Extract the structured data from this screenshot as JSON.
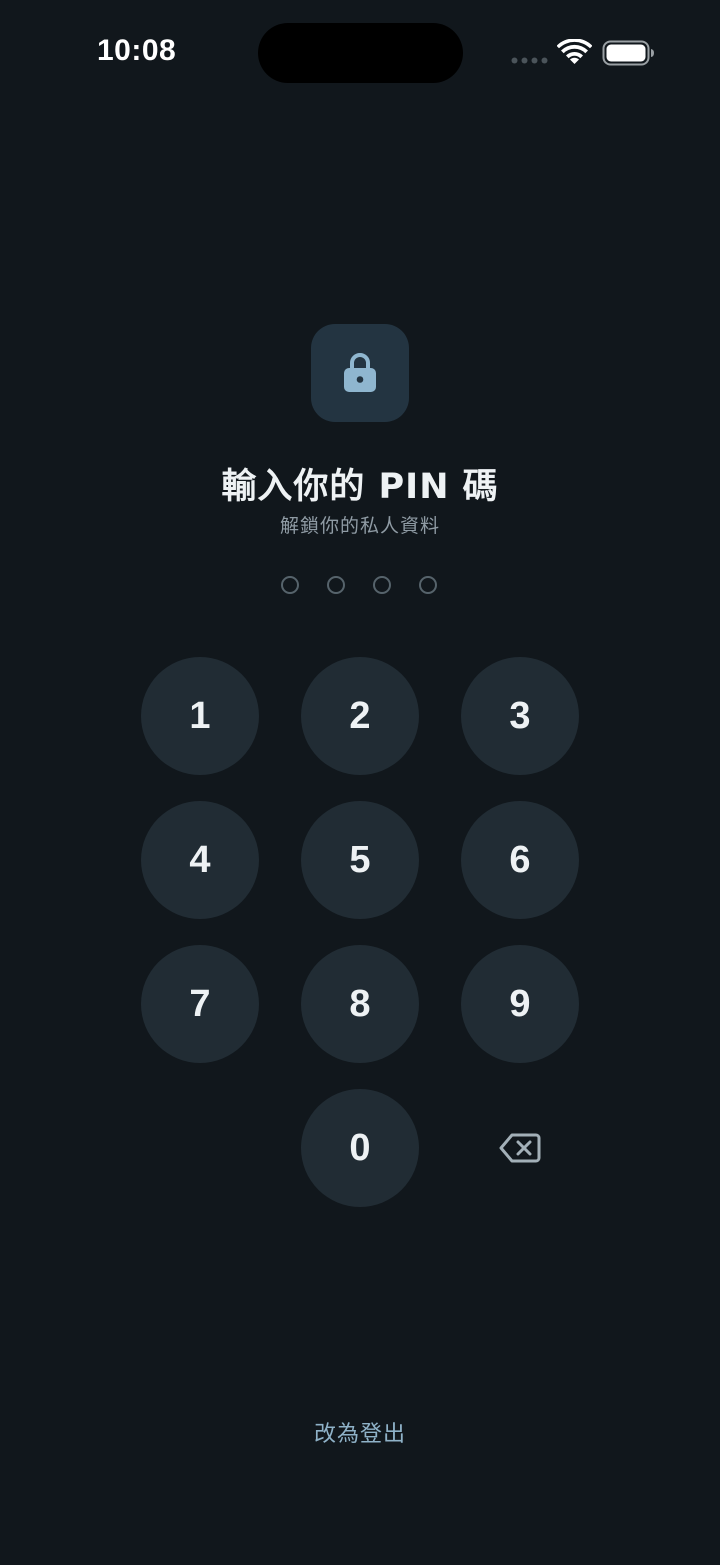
{
  "status_bar": {
    "time": "10:08"
  },
  "icons": {
    "lock": "lock-icon",
    "backspace": "backspace-icon",
    "wifi": "wifi-icon",
    "battery": "battery-icon",
    "signal": "signal-icon"
  },
  "lock_screen": {
    "title": "輸入你的 PIN 碼",
    "subtitle": "解鎖你的私人資料",
    "pin_length": 4,
    "pin_entered": 0
  },
  "keypad": {
    "keys": [
      "1",
      "2",
      "3",
      "4",
      "5",
      "6",
      "7",
      "8",
      "9",
      "0"
    ]
  },
  "footer": {
    "logout_label": "改為登出"
  },
  "colors": {
    "background": "#11171c",
    "key_fill": "#212c34",
    "lock_badge": "#233441",
    "lock_glyph": "#8fb6cf",
    "accent_link": "#8fb2c8"
  }
}
